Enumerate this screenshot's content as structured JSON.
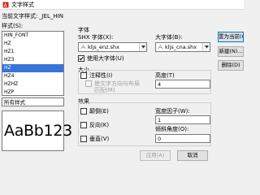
{
  "window": {
    "title": "文字样式"
  },
  "current_style": {
    "label": "当前文字样式:",
    "value": "_JEL_HIN"
  },
  "styles": {
    "label": "样式(S):",
    "items": [
      {
        "name": "HIN_FONT",
        "selected": false
      },
      {
        "name": "HZ",
        "selected": false
      },
      {
        "name": "HZ1",
        "selected": false
      },
      {
        "name": "HZ3",
        "selected": false
      },
      {
        "name": "HZ",
        "selected": true
      },
      {
        "name": "HZ4",
        "selected": false
      },
      {
        "name": "HZHZ",
        "selected": false
      },
      {
        "name": "HZP",
        "selected": false
      }
    ],
    "filter_value": "所有样式"
  },
  "preview": {
    "sample_text": "AaBb123"
  },
  "font": {
    "group_label": "字体",
    "shx_label": "SHX 字体(X):",
    "shx_value": "kljs_enz.shx",
    "bigfont_label": "大字体(B):",
    "bigfont_value": "kljs_cna.shx",
    "use_bigfont_label": "使用大字体(U)",
    "use_bigfont_checked": true
  },
  "size": {
    "group_label": "大小",
    "annotative_label": "注释性(I)",
    "match_orientation_label": "使文字方向与布局",
    "match_orientation_label2": "匹配(M)",
    "height_label": "高度(T)",
    "height_value": "4"
  },
  "effects": {
    "group_label": "效果",
    "upside_down_label": "颠倒(E)",
    "backwards_label": "反向(K)",
    "vertical_label": "垂直(V)",
    "width_factor_label": "宽度因子(W):",
    "width_factor_value": "1",
    "oblique_label": "倾斜角度(O):",
    "oblique_value": "0"
  },
  "buttons": {
    "set_current": "置为当前(C)",
    "new": "新建(N)...",
    "delete": "删除(D)",
    "apply": "应用(A)",
    "cancel": "取消"
  },
  "colors": {
    "selection": "#3874d8",
    "accent": "#0078d7"
  }
}
